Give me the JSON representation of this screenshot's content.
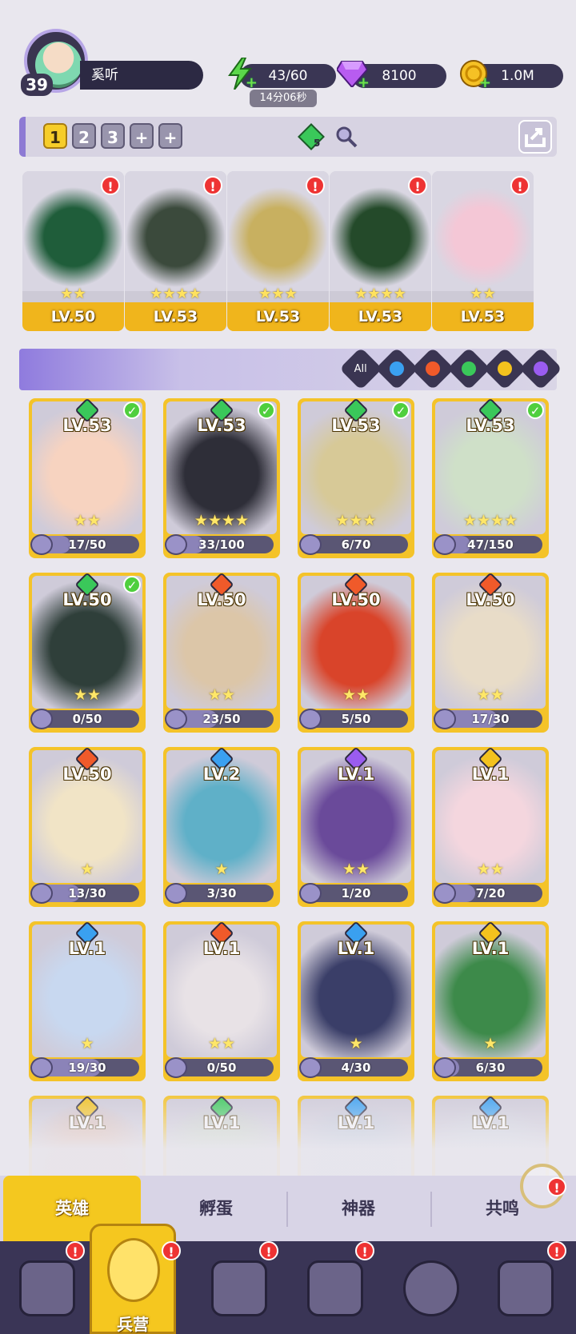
{
  "player": {
    "level": "39",
    "name": "奚听"
  },
  "resources": [
    {
      "name": "energy",
      "icon": "lightning-icon",
      "value": "43/60",
      "color": "#5bd84a"
    },
    {
      "name": "gems",
      "icon": "gem-icon",
      "value": "8100",
      "color": "#b85cf0"
    },
    {
      "name": "gold",
      "icon": "coin-icon",
      "value": "1.0M",
      "color": "#f5c125"
    }
  ],
  "energy_timer": "14分06秒",
  "team_slots": [
    "1",
    "2",
    "3",
    "+",
    "+"
  ],
  "team_badge": "5",
  "team": [
    {
      "level": "LV.50",
      "stars": "★★",
      "alert": "!"
    },
    {
      "level": "LV.53",
      "stars": "★★★★",
      "alert": "!"
    },
    {
      "level": "LV.53",
      "stars": "★★★",
      "alert": "!"
    },
    {
      "level": "LV.53",
      "stars": "★★★★",
      "alert": "!"
    },
    {
      "level": "LV.53",
      "stars": "★★",
      "alert": "!"
    }
  ],
  "element_filters": [
    {
      "label": "All",
      "icon": "all-filter-icon",
      "color": "#ffffff"
    },
    {
      "label": "",
      "icon": "water-element-icon",
      "color": "#3aa0f0"
    },
    {
      "label": "",
      "icon": "fire-element-icon",
      "color": "#f05a2a"
    },
    {
      "label": "",
      "icon": "nature-element-icon",
      "color": "#3ac85a"
    },
    {
      "label": "",
      "icon": "light-element-icon",
      "color": "#f3c21e"
    },
    {
      "label": "",
      "icon": "dark-element-icon",
      "color": "#9a5cf0"
    }
  ],
  "heroes": [
    {
      "level": "LV.53",
      "element": "nature",
      "color": "#3ac85a",
      "stars": "★★",
      "progress": "17/50",
      "ratio": 0.34,
      "checked": true
    },
    {
      "level": "LV.53",
      "element": "nature",
      "color": "#3ac85a",
      "stars": "★★★★",
      "progress": "33/100",
      "ratio": 0.33,
      "checked": true
    },
    {
      "level": "LV.53",
      "element": "nature",
      "color": "#3ac85a",
      "stars": "★★★",
      "progress": "6/70",
      "ratio": 0.09,
      "checked": true
    },
    {
      "level": "LV.53",
      "element": "nature",
      "color": "#3ac85a",
      "stars": "★★★★",
      "progress": "47/150",
      "ratio": 0.31,
      "checked": true
    },
    {
      "level": "LV.50",
      "element": "nature",
      "color": "#3ac85a",
      "stars": "★★",
      "progress": "0/50",
      "ratio": 0.0,
      "checked": true
    },
    {
      "level": "LV.50",
      "element": "fire",
      "color": "#f05a2a",
      "stars": "★★",
      "progress": "23/50",
      "ratio": 0.46,
      "checked": false
    },
    {
      "level": "LV.50",
      "element": "fire",
      "color": "#f05a2a",
      "stars": "★★",
      "progress": "5/50",
      "ratio": 0.1,
      "checked": false
    },
    {
      "level": "LV.50",
      "element": "fire",
      "color": "#f05a2a",
      "stars": "★★",
      "progress": "17/30",
      "ratio": 0.57,
      "checked": false
    },
    {
      "level": "LV.50",
      "element": "fire",
      "color": "#f05a2a",
      "stars": "★",
      "progress": "13/30",
      "ratio": 0.43,
      "checked": false
    },
    {
      "level": "LV.2",
      "element": "water",
      "color": "#3aa0f0",
      "stars": "★",
      "progress": "3/30",
      "ratio": 0.1,
      "checked": false
    },
    {
      "level": "LV.1",
      "element": "dark",
      "color": "#9a5cf0",
      "stars": "★★",
      "progress": "1/20",
      "ratio": 0.05,
      "checked": false
    },
    {
      "level": "LV.1",
      "element": "light",
      "color": "#f3c21e",
      "stars": "★★",
      "progress": "7/20",
      "ratio": 0.35,
      "checked": false
    },
    {
      "level": "LV.1",
      "element": "water",
      "color": "#3aa0f0",
      "stars": "★",
      "progress": "19/30",
      "ratio": 0.63,
      "checked": false
    },
    {
      "level": "LV.1",
      "element": "fire",
      "color": "#f05a2a",
      "stars": "★★",
      "progress": "0/50",
      "ratio": 0.0,
      "checked": false
    },
    {
      "level": "LV.1",
      "element": "water",
      "color": "#3aa0f0",
      "stars": "★",
      "progress": "4/30",
      "ratio": 0.13,
      "checked": false
    },
    {
      "level": "LV.1",
      "element": "light",
      "color": "#f3c21e",
      "stars": "★",
      "progress": "6/30",
      "ratio": 0.2,
      "checked": false
    },
    {
      "level": "LV.1",
      "element": "light",
      "color": "#f3c21e",
      "stars": "",
      "progress": "",
      "ratio": 0,
      "checked": false
    },
    {
      "level": "LV.1",
      "element": "nature",
      "color": "#3ac85a",
      "stars": "",
      "progress": "",
      "ratio": 0,
      "checked": false
    },
    {
      "level": "LV.1",
      "element": "water",
      "color": "#3aa0f0",
      "stars": "",
      "progress": "",
      "ratio": 0,
      "checked": false
    },
    {
      "level": "LV.1",
      "element": "water",
      "color": "#3aa0f0",
      "stars": "",
      "progress": "",
      "ratio": 0,
      "checked": false
    }
  ],
  "tabs": [
    "英雄",
    "孵蛋",
    "神器",
    "共鸣"
  ],
  "nav": {
    "active_label": "兵营",
    "alert": "!"
  }
}
